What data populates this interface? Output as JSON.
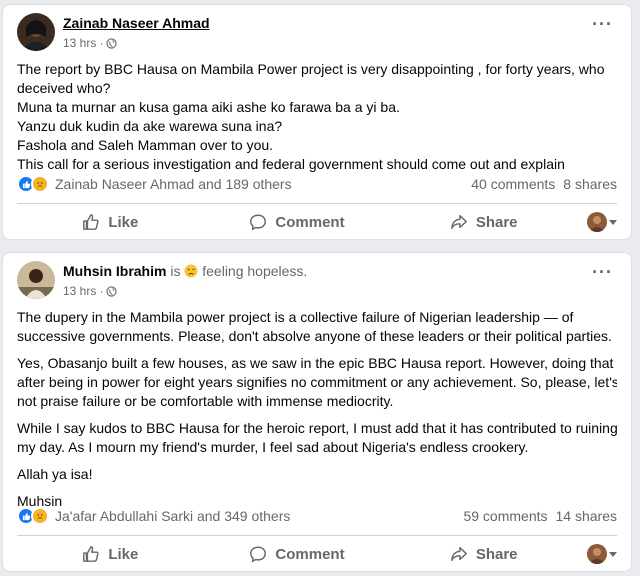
{
  "posts": [
    {
      "author": "Zainab Naseer Ahmad",
      "status": "",
      "time": "13 hrs ·",
      "lines": [
        "The report by BBC Hausa on Mambila Power project is very disappointing , for forty years, who",
        "deceived who?",
        "Muna ta murnar an kusa gama aiki ashe ko farawa ba a yi ba.",
        "Yanzu duk kudin da ake warewa suna ina?",
        "Fashola and Saleh Mamman over to you.",
        "This call for a serious investigation and federal government should come out and explain"
      ],
      "reactions_text": "Zainab Naseer Ahmad and 189 others",
      "comments": "40 comments",
      "shares": "8 shares",
      "like_label": "Like",
      "comment_label": "Comment",
      "share_label": "Share"
    },
    {
      "author": "Muhsin Ibrahim",
      "status_prefix": "is",
      "status": "feeling hopeless.",
      "time": "13 hrs ·",
      "paragraphs": [
        [
          "The dupery in the Mambila power project is a collective failure of Nigerian leadership — of",
          "successive governments. Please, don't absolve anyone of these leaders or their political parties."
        ],
        [
          "Yes, Obasanjo built a few houses, as we saw in the epic BBC Hausa report. However, doing that",
          "after being in power for eight years signifies no commitment or any achievement. So, please, let's",
          "not praise failure or be comfortable with immense mediocrity."
        ],
        [
          "While I say kudos to BBC Hausa for the heroic report, I must add that it has contributed to ruining",
          "my day. As I mourn my friend's murder, I feel sad about Nigeria's endless crookery."
        ],
        [
          "Allah ya isa!"
        ],
        [
          "Muhsin"
        ]
      ],
      "reactions_text": "Ja'afar Abdullahi Sarki and 349 others",
      "comments": "59 comments",
      "shares": "14 shares",
      "like_label": "Like",
      "comment_label": "Comment",
      "share_label": "Share"
    }
  ],
  "colors": {
    "like_blue": "#1877f2",
    "sad_yellow": "#f7b125",
    "meta_gray": "#65676b"
  }
}
